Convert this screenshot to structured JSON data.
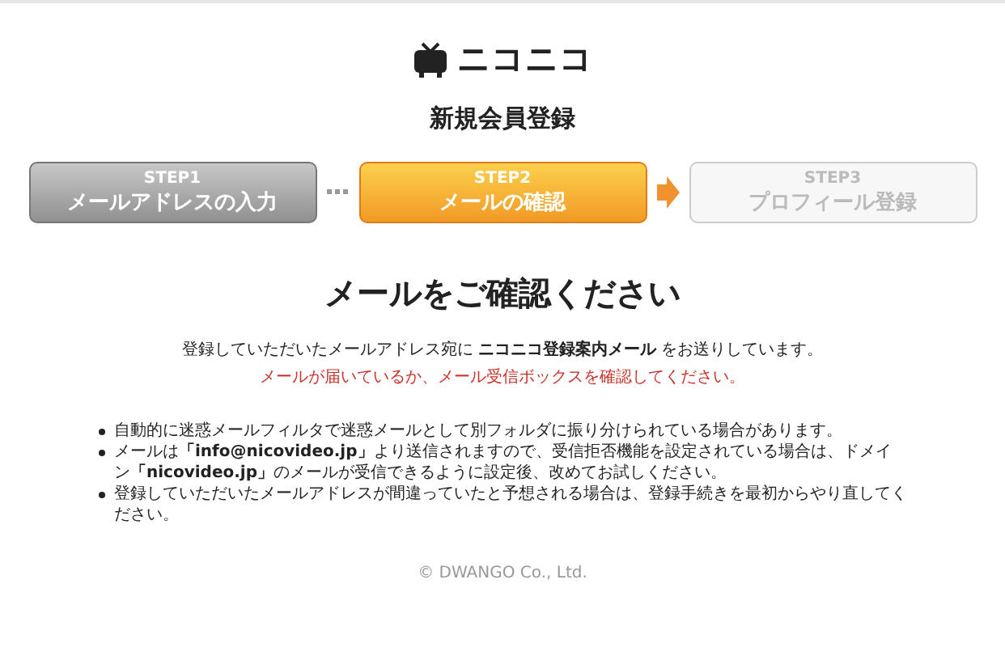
{
  "logo": {
    "text": "ニコニコ"
  },
  "title": "新規会員登録",
  "steps": [
    {
      "label": "STEP1",
      "name": "メールアドレスの入力",
      "kind": "done"
    },
    {
      "label": "STEP2",
      "name": "メールの確認",
      "kind": "current"
    },
    {
      "label": "STEP3",
      "name": "プロフィール登録",
      "kind": "upcoming"
    }
  ],
  "heading": "メールをご確認ください",
  "intro": "登録していただいたメールアドレス宛に **ニコニコ登録案内メール** をお送りしています。",
  "warning": "メールが届いているか、メール受信ボックスを確認してください。",
  "notes": [
    "自動的に迷惑メールフィルタで迷惑メールとして別フォルダに振り分けられている場合があります。",
    "メールは**「info@nicovideo.jp」**より送信されますので、受信拒否機能を設定されている場合は、ドメイン**「nicovideo.jp」**のメールが受信できるように設定後、改めてお試しください。",
    "登録していただいたメールアドレスが間違っていたと予想される場合は、登録手続きを最初からやり直してください。"
  ],
  "footer": "© DWANGO Co., Ltd."
}
